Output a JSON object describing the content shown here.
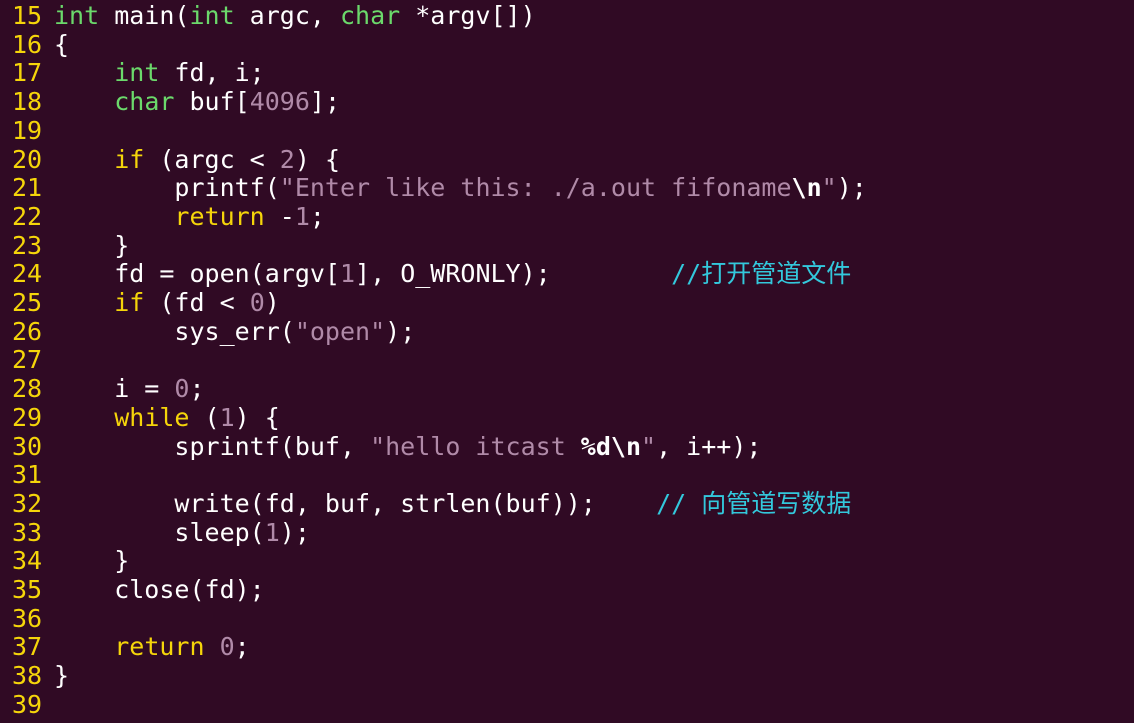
{
  "editor": {
    "colors": {
      "background": "#300a24",
      "line_number": "#f5d50a",
      "plain": "#ffffff",
      "type": "#6bd96b",
      "keyword": "#f5d50a",
      "number": "#b08aa8",
      "string": "#b08aa8",
      "comment": "#33c8dc"
    },
    "lines": [
      {
        "num": "15",
        "tokens": [
          [
            "t-type",
            "int"
          ],
          [
            "t-plain",
            " main("
          ],
          [
            "t-type",
            "int"
          ],
          [
            "t-plain",
            " argc, "
          ],
          [
            "t-type",
            "char"
          ],
          [
            "t-plain",
            " *argv[])"
          ]
        ]
      },
      {
        "num": "16",
        "tokens": [
          [
            "t-plain",
            "{"
          ]
        ]
      },
      {
        "num": "17",
        "tokens": [
          [
            "t-plain",
            "    "
          ],
          [
            "t-type",
            "int"
          ],
          [
            "t-plain",
            " fd, i;"
          ]
        ]
      },
      {
        "num": "18",
        "tokens": [
          [
            "t-plain",
            "    "
          ],
          [
            "t-type",
            "char"
          ],
          [
            "t-plain",
            " buf["
          ],
          [
            "t-num",
            "4096"
          ],
          [
            "t-plain",
            "];"
          ]
        ]
      },
      {
        "num": "19",
        "tokens": []
      },
      {
        "num": "20",
        "tokens": [
          [
            "t-plain",
            "    "
          ],
          [
            "t-kw",
            "if"
          ],
          [
            "t-plain",
            " (argc < "
          ],
          [
            "t-num",
            "2"
          ],
          [
            "t-plain",
            ") {"
          ]
        ]
      },
      {
        "num": "21",
        "tokens": [
          [
            "t-plain",
            "        printf("
          ],
          [
            "t-str",
            "\"Enter like this: ./a.out fifoname"
          ],
          [
            "t-esc",
            "\\n"
          ],
          [
            "t-str",
            "\""
          ],
          [
            "t-plain",
            ");"
          ]
        ]
      },
      {
        "num": "22",
        "tokens": [
          [
            "t-plain",
            "        "
          ],
          [
            "t-kw",
            "return"
          ],
          [
            "t-plain",
            " -"
          ],
          [
            "t-num",
            "1"
          ],
          [
            "t-plain",
            ";"
          ]
        ]
      },
      {
        "num": "23",
        "tokens": [
          [
            "t-plain",
            "    }"
          ]
        ]
      },
      {
        "num": "24",
        "tokens": [
          [
            "t-plain",
            "    fd = open(argv["
          ],
          [
            "t-num",
            "1"
          ],
          [
            "t-plain",
            "], O_WRONLY);        "
          ],
          [
            "t-comment",
            "//打开管道文件"
          ]
        ]
      },
      {
        "num": "25",
        "tokens": [
          [
            "t-plain",
            "    "
          ],
          [
            "t-kw",
            "if"
          ],
          [
            "t-plain",
            " (fd < "
          ],
          [
            "t-num",
            "0"
          ],
          [
            "t-plain",
            ")"
          ]
        ]
      },
      {
        "num": "26",
        "tokens": [
          [
            "t-plain",
            "        sys_err("
          ],
          [
            "t-str",
            "\"open\""
          ],
          [
            "t-plain",
            ");"
          ]
        ]
      },
      {
        "num": "27",
        "tokens": []
      },
      {
        "num": "28",
        "tokens": [
          [
            "t-plain",
            "    i = "
          ],
          [
            "t-num",
            "0"
          ],
          [
            "t-plain",
            ";"
          ]
        ]
      },
      {
        "num": "29",
        "tokens": [
          [
            "t-plain",
            "    "
          ],
          [
            "t-kw",
            "while"
          ],
          [
            "t-plain",
            " ("
          ],
          [
            "t-num",
            "1"
          ],
          [
            "t-plain",
            ") {"
          ]
        ]
      },
      {
        "num": "30",
        "tokens": [
          [
            "t-plain",
            "        sprintf(buf, "
          ],
          [
            "t-str",
            "\"hello itcast "
          ],
          [
            "t-esc",
            "%d\\n"
          ],
          [
            "t-str",
            "\""
          ],
          [
            "t-plain",
            ", i++);"
          ]
        ]
      },
      {
        "num": "31",
        "tokens": []
      },
      {
        "num": "32",
        "tokens": [
          [
            "t-plain",
            "        write(fd, buf, strlen(buf));    "
          ],
          [
            "t-comment",
            "// 向管道写数据"
          ]
        ]
      },
      {
        "num": "33",
        "tokens": [
          [
            "t-plain",
            "        sleep("
          ],
          [
            "t-num",
            "1"
          ],
          [
            "t-plain",
            ");"
          ]
        ]
      },
      {
        "num": "34",
        "tokens": [
          [
            "t-plain",
            "    }"
          ]
        ]
      },
      {
        "num": "35",
        "tokens": [
          [
            "t-plain",
            "    close(fd);"
          ]
        ]
      },
      {
        "num": "36",
        "tokens": []
      },
      {
        "num": "37",
        "tokens": [
          [
            "t-plain",
            "    "
          ],
          [
            "t-kw",
            "return"
          ],
          [
            "t-plain",
            " "
          ],
          [
            "t-num",
            "0"
          ],
          [
            "t-plain",
            ";"
          ]
        ]
      },
      {
        "num": "38",
        "tokens": [
          [
            "t-plain",
            "}"
          ]
        ]
      },
      {
        "num": "39",
        "tokens": []
      }
    ]
  }
}
